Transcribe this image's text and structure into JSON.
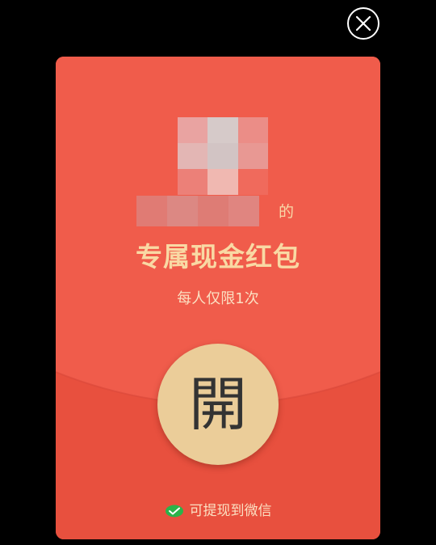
{
  "close_button": {
    "icon": "close-icon",
    "color": "#ffffff"
  },
  "envelope": {
    "colors": {
      "upper": "#f05c4b",
      "lower": "#e8503e",
      "accent_gold": "#f9d9a4",
      "button_gold": "#ebcd99"
    },
    "avatar": {
      "icon": "avatar-pixelated"
    },
    "sender": {
      "name_blurred": "",
      "suffix": "的"
    },
    "title": "专属现金红包",
    "subtitle": "每人仅限1次",
    "open_button_label": "開",
    "footer": {
      "icon": "wechat-pay-icon",
      "text": "可提现到微信"
    }
  }
}
